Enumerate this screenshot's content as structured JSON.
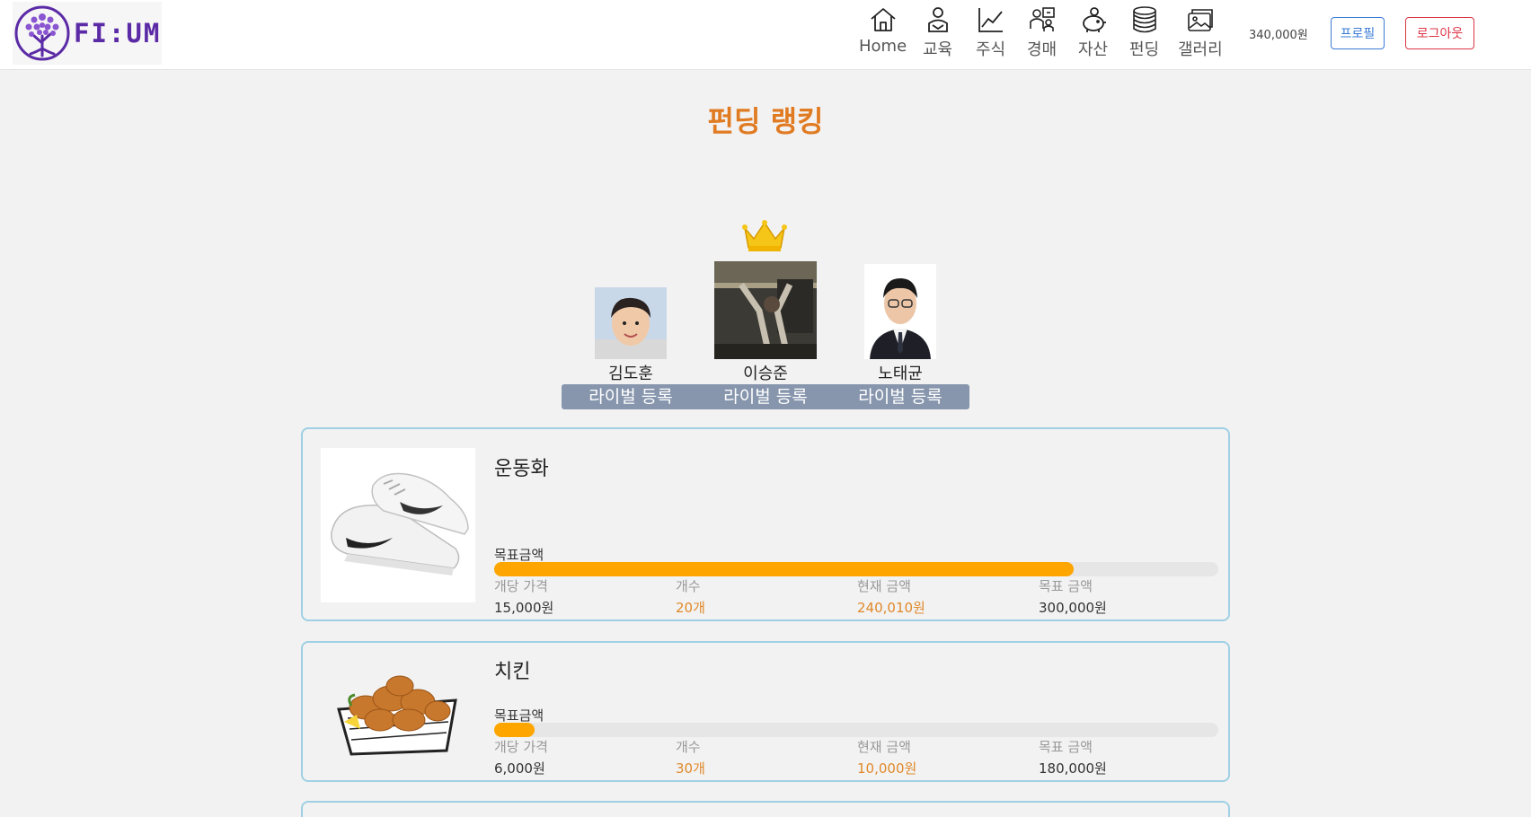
{
  "header": {
    "logo_text": "FI:UM",
    "nav": [
      {
        "label": "Home",
        "icon": "home-icon"
      },
      {
        "label": "교육",
        "icon": "education-icon"
      },
      {
        "label": "주식",
        "icon": "stock-chart-icon"
      },
      {
        "label": "경매",
        "icon": "auction-icon"
      },
      {
        "label": "자산",
        "icon": "piggy-bank-icon"
      },
      {
        "label": "펀딩",
        "icon": "coins-icon"
      },
      {
        "label": "갤러리",
        "icon": "gallery-icon"
      }
    ],
    "balance": "340,000원",
    "profile_label": "프로필",
    "logout_label": "로그아웃"
  },
  "page": {
    "title": "펀딩 랭킹"
  },
  "ranking": [
    {
      "name": "김도훈",
      "rival_label": "라이벌 등록"
    },
    {
      "name": "이승준",
      "rival_label": "라이벌 등록",
      "crown": true
    },
    {
      "name": "노태균",
      "rival_label": "라이벌 등록"
    }
  ],
  "stat_labels": {
    "goal_label": "목표금액",
    "unit_price": "개당 가격",
    "count": "개수",
    "current": "현재 금액",
    "target": "목표 금액"
  },
  "fundings": [
    {
      "name": "운동화",
      "progress": 0.8,
      "unit_price": "15,000원",
      "count": "20개",
      "current": "240,010원",
      "target": "300,000원"
    },
    {
      "name": "치킨",
      "progress": 0.0556,
      "unit_price": "6,000원",
      "count": "30개",
      "current": "10,000원",
      "target": "180,000원"
    }
  ],
  "colors": {
    "accent_orange": "#ffa500",
    "title_orange": "#e07b22",
    "brand_purple": "#5b2aa6",
    "rival_bar": "#8796ad",
    "card_border": "#9fd0e4"
  }
}
